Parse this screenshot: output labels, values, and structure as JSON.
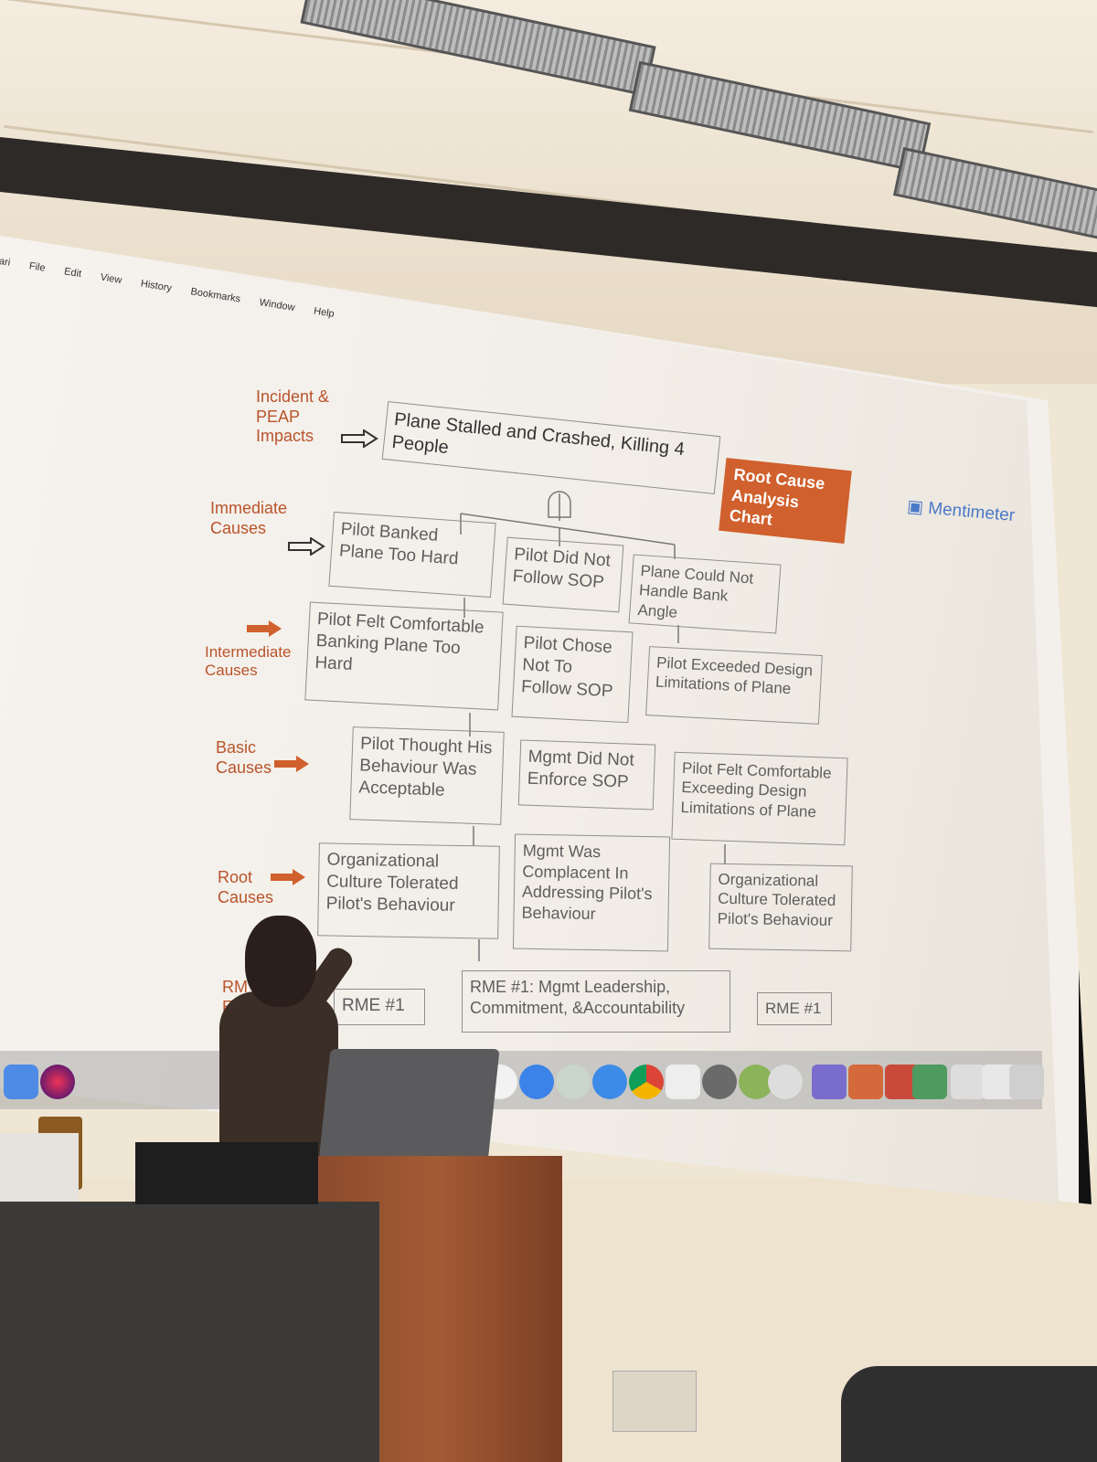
{
  "browser": {
    "menu": [
      "ari",
      "File",
      "Edit",
      "View",
      "History",
      "Bookmarks",
      "Window",
      "Help"
    ]
  },
  "slide": {
    "badge": "Root Cause Analysis Chart",
    "brand": "Mentimeter",
    "labels": {
      "incident": "Incident & PEAP Impacts",
      "immediate": "Immediate Causes",
      "intermediate": "Intermediate Causes",
      "basic": "Basic Causes",
      "root": "Root Causes",
      "rme": "RM E"
    },
    "top": "Plane Stalled and Crashed, Killing 4 People",
    "immediate": [
      "Pilot Banked Plane Too Hard",
      "Pilot Did Not Follow SOP",
      "Plane Could Not Handle Bank Angle"
    ],
    "intermediate": [
      "Pilot Felt Comfortable Banking Plane Too Hard",
      "Pilot Chose Not To Follow SOP",
      "Pilot Exceeded Design Limitations of Plane"
    ],
    "basic": [
      "Pilot Thought His Behaviour Was Acceptable",
      "Mgmt Did Not Enforce SOP",
      "Pilot Felt Comfortable Exceeding Design Limitations of Plane"
    ],
    "root": [
      "Organizational Culture Tolerated Pilot's Behaviour",
      "Mgmt Was Complacent In Addressing Pilot's Behaviour",
      "Organizational Culture Tolerated Pilot's Behaviour"
    ],
    "rme": [
      "RME #1",
      "RME #1: Mgmt Leadership, Commitment, &Accountability",
      "RME #1"
    ]
  },
  "colors": {
    "accent": "#d0602d",
    "label": "#b9542b",
    "menti": "#4a79c8"
  }
}
